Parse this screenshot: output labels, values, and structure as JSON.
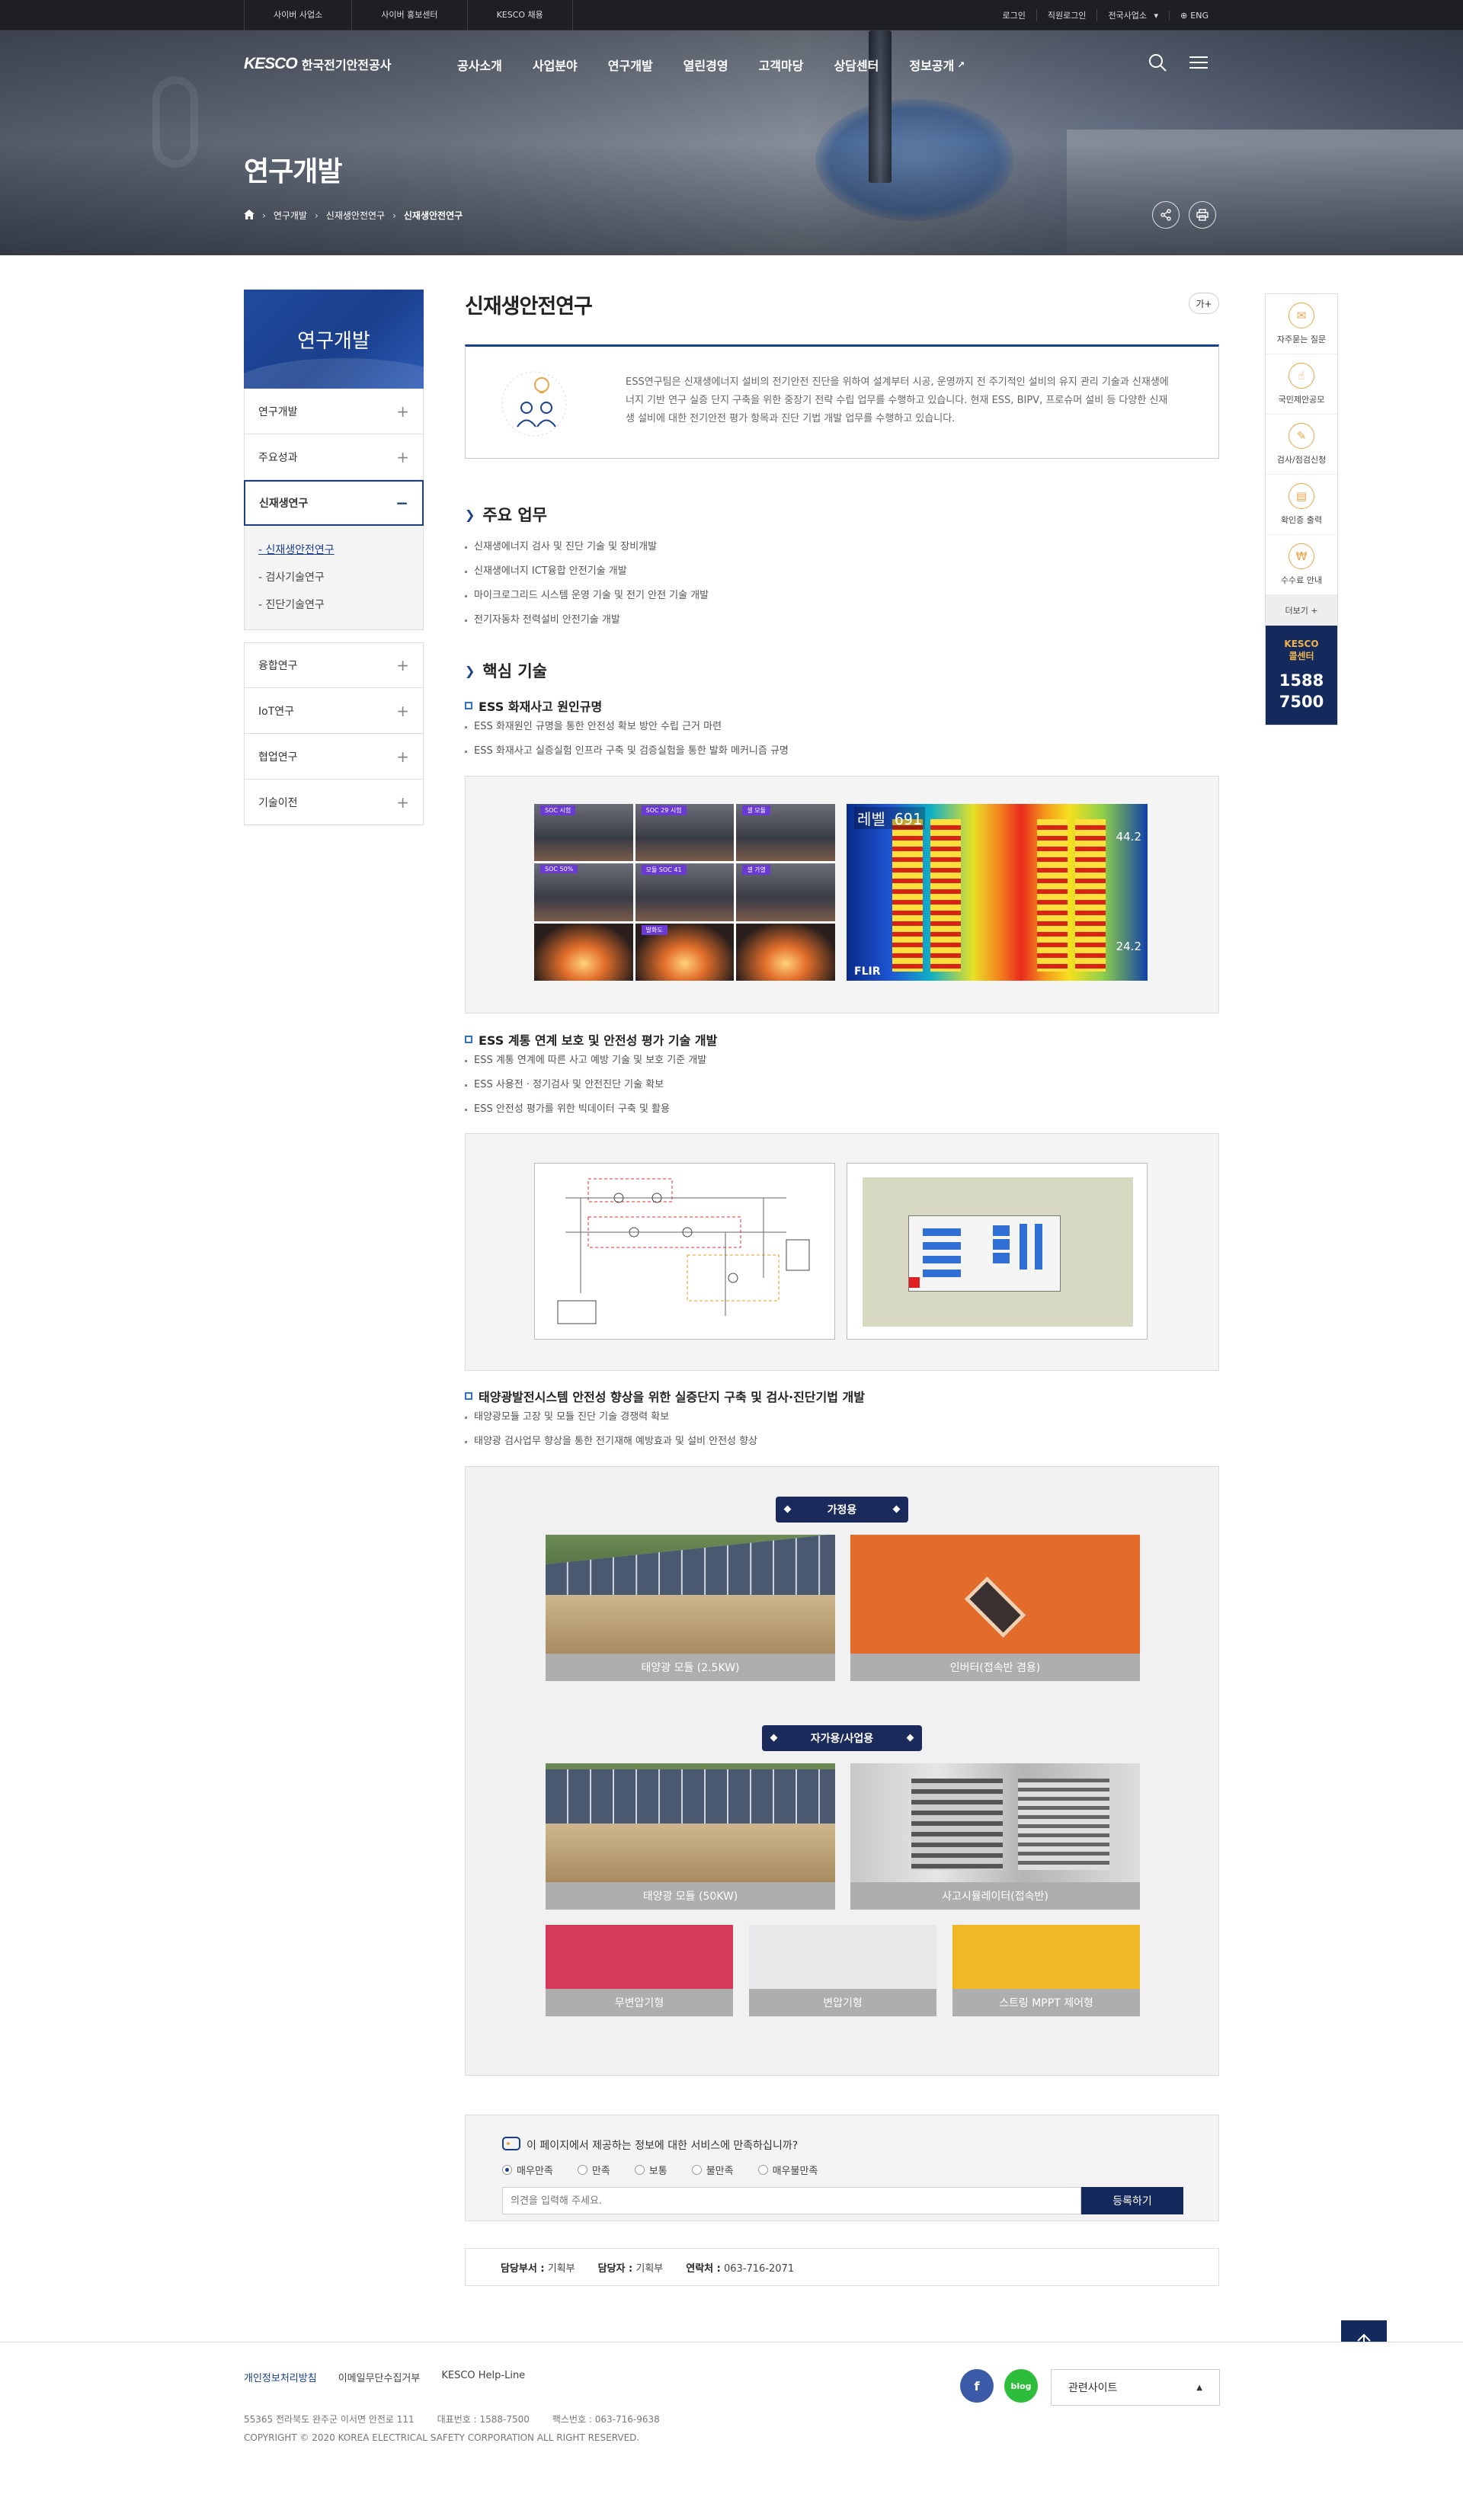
{
  "topbar": {
    "sites": [
      "사이버 사업소",
      "사이버 홍보센터",
      "KESCO 채용"
    ],
    "util": [
      "로그인",
      "직원로그인",
      "전국사업소",
      "ENG"
    ]
  },
  "header": {
    "logo_mark": "KESCO",
    "logo_name": "한국전기안전공사",
    "gnb": [
      "공사소개",
      "사업분야",
      "연구개발",
      "열린경영",
      "고객마당",
      "상담센터",
      "정보공개"
    ]
  },
  "hero": {
    "title": "연구개발",
    "breadcrumb": [
      "연구개발",
      "신재생안전연구",
      "신재생안전연구"
    ]
  },
  "lnb": {
    "title": "연구개발",
    "items_top": [
      "연구개발",
      "주요성과"
    ],
    "active": "신재생연구",
    "sub": [
      "신재생안전연구",
      "검사기술연구",
      "진단기술연구"
    ],
    "items_bottom": [
      "융합연구",
      "IoT연구",
      "협업연구",
      "기술이전"
    ]
  },
  "main": {
    "title": "신재생안전연구",
    "font_button": "가+",
    "intro": "ESS연구팀은 신재생에너지 설비의 전기안전 진단을 위하여 설계부터 시공, 운영까지 전 주기적인 설비의 유지 관리 기술과 신재생에너지 기반 연구 실증 단지 구축을 위한 중장기 전략 수립 업무를 수행하고 있습니다. 현재 ESS, BIPV, 프로슈머 설비 등 다양한 신재생 설비에 대한 전기안전 평가 항목과 진단 기법 개발 업무를 수행하고 있습니다.",
    "duties_title": "주요 업무",
    "duties": [
      "신재생에너지 검사 및 진단 기술 및 장비개발",
      "신재생에너지 ICT융합 안전기술 개발",
      "마이크로그리드 시스템 운영 기술 및 전기 안전 기술 개발",
      "전기자동차 전력설비 안전기술 개발"
    ],
    "core_title": "핵심 기술",
    "tech1": {
      "title": "ESS 화재사고 원인규명",
      "items": [
        "ESS 화재원인 규명을 통한 안전성 확보 방안 수립 근거 마련",
        "ESS 화재사고 실증실험 인프라 구축 및 검증실험을 통한 발화 메커니즘 규명"
      ],
      "thermal_reading": "레벨 691",
      "thermal_high": "44.2",
      "thermal_low": "24.2",
      "thermal_brand": "FLIR",
      "grid_labels": [
        "SOC 시험",
        "SOC 29 시험",
        "셀 모듈",
        "SOC 50%",
        "모듈 SOC 41",
        "셀 가열",
        "",
        "발화도",
        ""
      ]
    },
    "tech2": {
      "title": "ESS 계통 연계 보호 및 안전성 평가 기술 개발",
      "items": [
        "ESS 계통 연계에 따른 사고 예방 기술 및 보호 기준 개발",
        "ESS 사용전 · 정기검사 및 안전진단 기술 확보",
        "ESS 안전성 평가를 위한 빅데이터 구축 및 활용"
      ]
    },
    "tech3": {
      "title": "태양광발전시스템 안전성 향상을 위한 실증단지 구축 및 검사·진단기법 개발",
      "items": [
        "태양광모듈 고장 및 모듈 진단 기술 경쟁력 확보",
        "태양광 검사업무 향상을 통한 전기재해 예방효과 및 설비 안전성 향상"
      ],
      "home_label": "가정용",
      "home_photos": [
        "태양광 모듈 (2.5KW)",
        "인버터(접속반 겸용)"
      ],
      "biz_label": "자가용/사업용",
      "biz_photos_top": [
        "태양광 모듈 (50KW)",
        "사고시뮬레이터(접속반)"
      ],
      "biz_photos_bottom": [
        "무변압기형",
        "변압기형",
        "스트링 MPPT 제어형"
      ]
    }
  },
  "survey": {
    "question": "이 페이지에서 제공하는 정보에 대한 서비스에 만족하십니까?",
    "options": [
      "매우만족",
      "만족",
      "보통",
      "불만족",
      "매우불만족"
    ],
    "placeholder": "의견을 입력해 주세요.",
    "submit": "등록하기"
  },
  "manager": {
    "dept_label": "담당부서 :",
    "dept": "기획부",
    "person_label": "담당자 :",
    "person": "기획부",
    "tel_label": "연락처 :",
    "tel": "063-716-2071"
  },
  "quick": {
    "items": [
      "자주묻는 질문",
      "국민제안공모",
      "검사/점검신청",
      "확인증 출력",
      "수수료 안내"
    ],
    "more": "더보기 +",
    "call_title": "KESCO 콜센터",
    "call_a": "1588",
    "call_b": "7500"
  },
  "footer": {
    "links": [
      "개인정보처리방침",
      "이메일무단수집거부",
      "KESCO Help-Line"
    ],
    "address": "55365 전라북도 완주군 이서면 안전로 111",
    "phone": "대표번호 : 1588-7500",
    "fax": "팩스번호 : 063-716-9638",
    "copyright": "COPYRIGHT © 2020 KOREA ELECTRICAL SAFETY CORPORATION ALL RIGHT RESERVED.",
    "facebook": "f",
    "blog": "blog",
    "related": "관련사이트"
  },
  "colors": {
    "brand": "#1a3f8c",
    "dark_navy": "#142a5c",
    "accent_orange": "#e8a64b"
  }
}
